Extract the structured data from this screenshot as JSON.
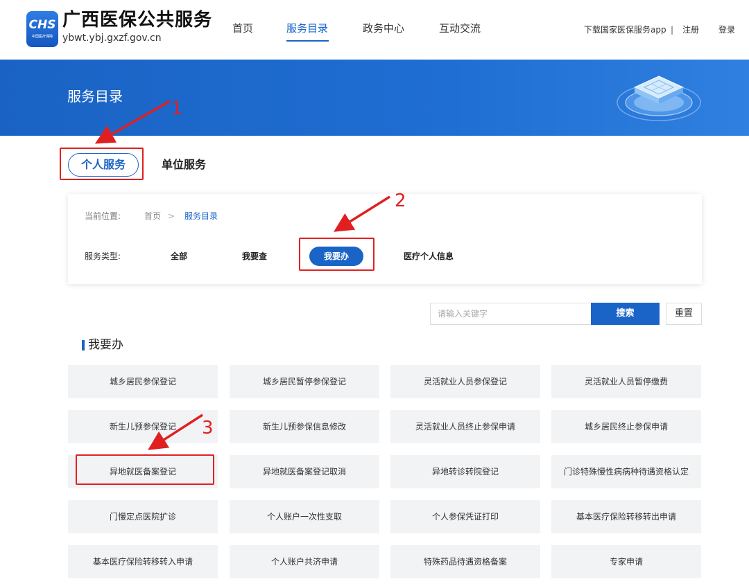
{
  "header": {
    "logo": {
      "mark": "CHS",
      "mark_sub": "中国医疗保障",
      "title": "广西医保公共服务",
      "domain": "ybwt.ybj.gxzf.gov.cn"
    },
    "nav": [
      {
        "label": "首页",
        "active": false
      },
      {
        "label": "服务目录",
        "active": true
      },
      {
        "label": "政务中心",
        "active": false
      },
      {
        "label": "互动交流",
        "active": false
      }
    ],
    "links": {
      "download_app": "下载国家医保服务app",
      "separator": "|",
      "register": "注册",
      "login": "登录"
    }
  },
  "banner": {
    "title": "服务目录"
  },
  "service_tabs": [
    {
      "label": "个人服务",
      "active": true
    },
    {
      "label": "单位服务",
      "active": false
    }
  ],
  "filter": {
    "breadcrumb": {
      "label": "当前位置:",
      "home": "首页",
      "separator": ">",
      "current": "服务目录"
    },
    "type_label": "服务类型:",
    "types": [
      {
        "label": "全部",
        "active": false
      },
      {
        "label": "我要查",
        "active": false
      },
      {
        "label": "我要办",
        "active": true
      },
      {
        "label": "医疗个人信息",
        "active": false
      }
    ]
  },
  "search": {
    "placeholder": "请输入关键字",
    "value": "",
    "search_label": "搜索",
    "reset_label": "重置"
  },
  "section": {
    "title": "我要办"
  },
  "services": [
    [
      "城乡居民参保登记",
      "城乡居民暂停参保登记",
      "灵活就业人员参保登记",
      "灵活就业人员暂停缴费"
    ],
    [
      "新生儿预参保登记",
      "新生儿预参保信息修改",
      "灵活就业人员终止参保申请",
      "城乡居民终止参保申请"
    ],
    [
      "异地就医备案登记",
      "异地就医备案登记取消",
      "异地转诊转院登记",
      "门诊特殊慢性病病种待遇资格认定"
    ],
    [
      "门慢定点医院扩诊",
      "个人账户一次性支取",
      "个人参保凭证打印",
      "基本医疗保险转移转出申请"
    ],
    [
      "基本医疗保险转移转入申请",
      "个人账户共济申请",
      "特殊药品待遇资格备案",
      "专家申请"
    ]
  ],
  "annotations": {
    "step1": "1",
    "step2": "2",
    "step3": "3",
    "color": "#e02020"
  },
  "colors": {
    "primary": "#1a64c8",
    "banner": "#1f6ed3",
    "tile": "#f2f3f5",
    "annotation": "#e02020"
  }
}
